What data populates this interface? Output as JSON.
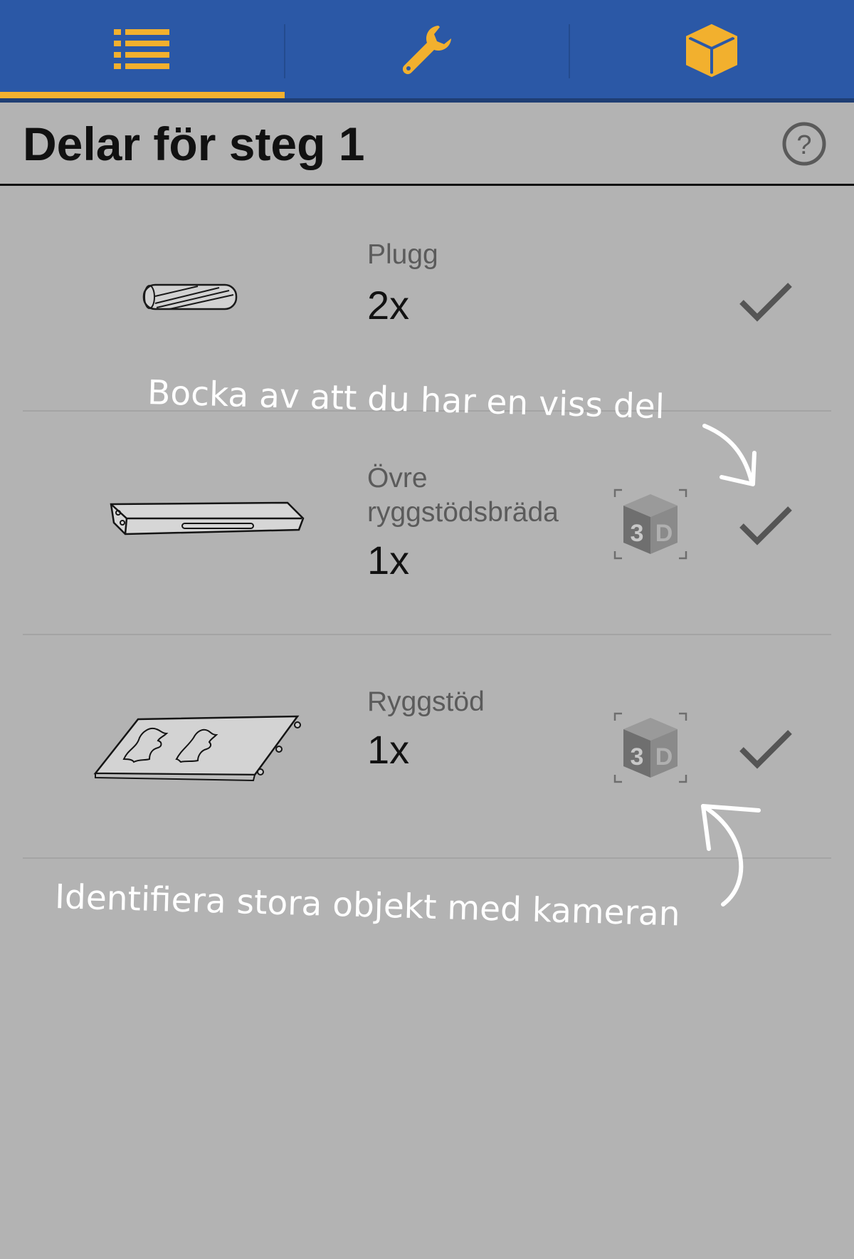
{
  "tabs": [
    {
      "name": "list",
      "icon": "list-icon",
      "active": true
    },
    {
      "name": "tools",
      "icon": "wrench-icon",
      "active": false
    },
    {
      "name": "3d-view",
      "icon": "cube-icon",
      "active": false
    }
  ],
  "colors": {
    "topbar": "#2b58a6",
    "accent": "#f2b02e",
    "background": "#b3b3b3"
  },
  "header": {
    "title": "Delar för steg 1",
    "help_icon": "help-icon"
  },
  "parts": [
    {
      "name": "Plugg",
      "quantity": "2x",
      "has_3d": false,
      "icon": "dowel-icon"
    },
    {
      "name": "Övre ryggstödsbräda",
      "name_line1": "Övre",
      "name_line2": "ryggstödsbräda",
      "quantity": "1x",
      "has_3d": true,
      "icon": "board-icon"
    },
    {
      "name": "Ryggstöd",
      "quantity": "1x",
      "has_3d": true,
      "icon": "backrest-panel-icon"
    }
  ],
  "annotations": {
    "check_hint": "Bocka av att du har en viss del",
    "camera_hint": "Identifiera stora objekt med kameran"
  },
  "labels_3d": {
    "left": "3",
    "right": "D"
  }
}
